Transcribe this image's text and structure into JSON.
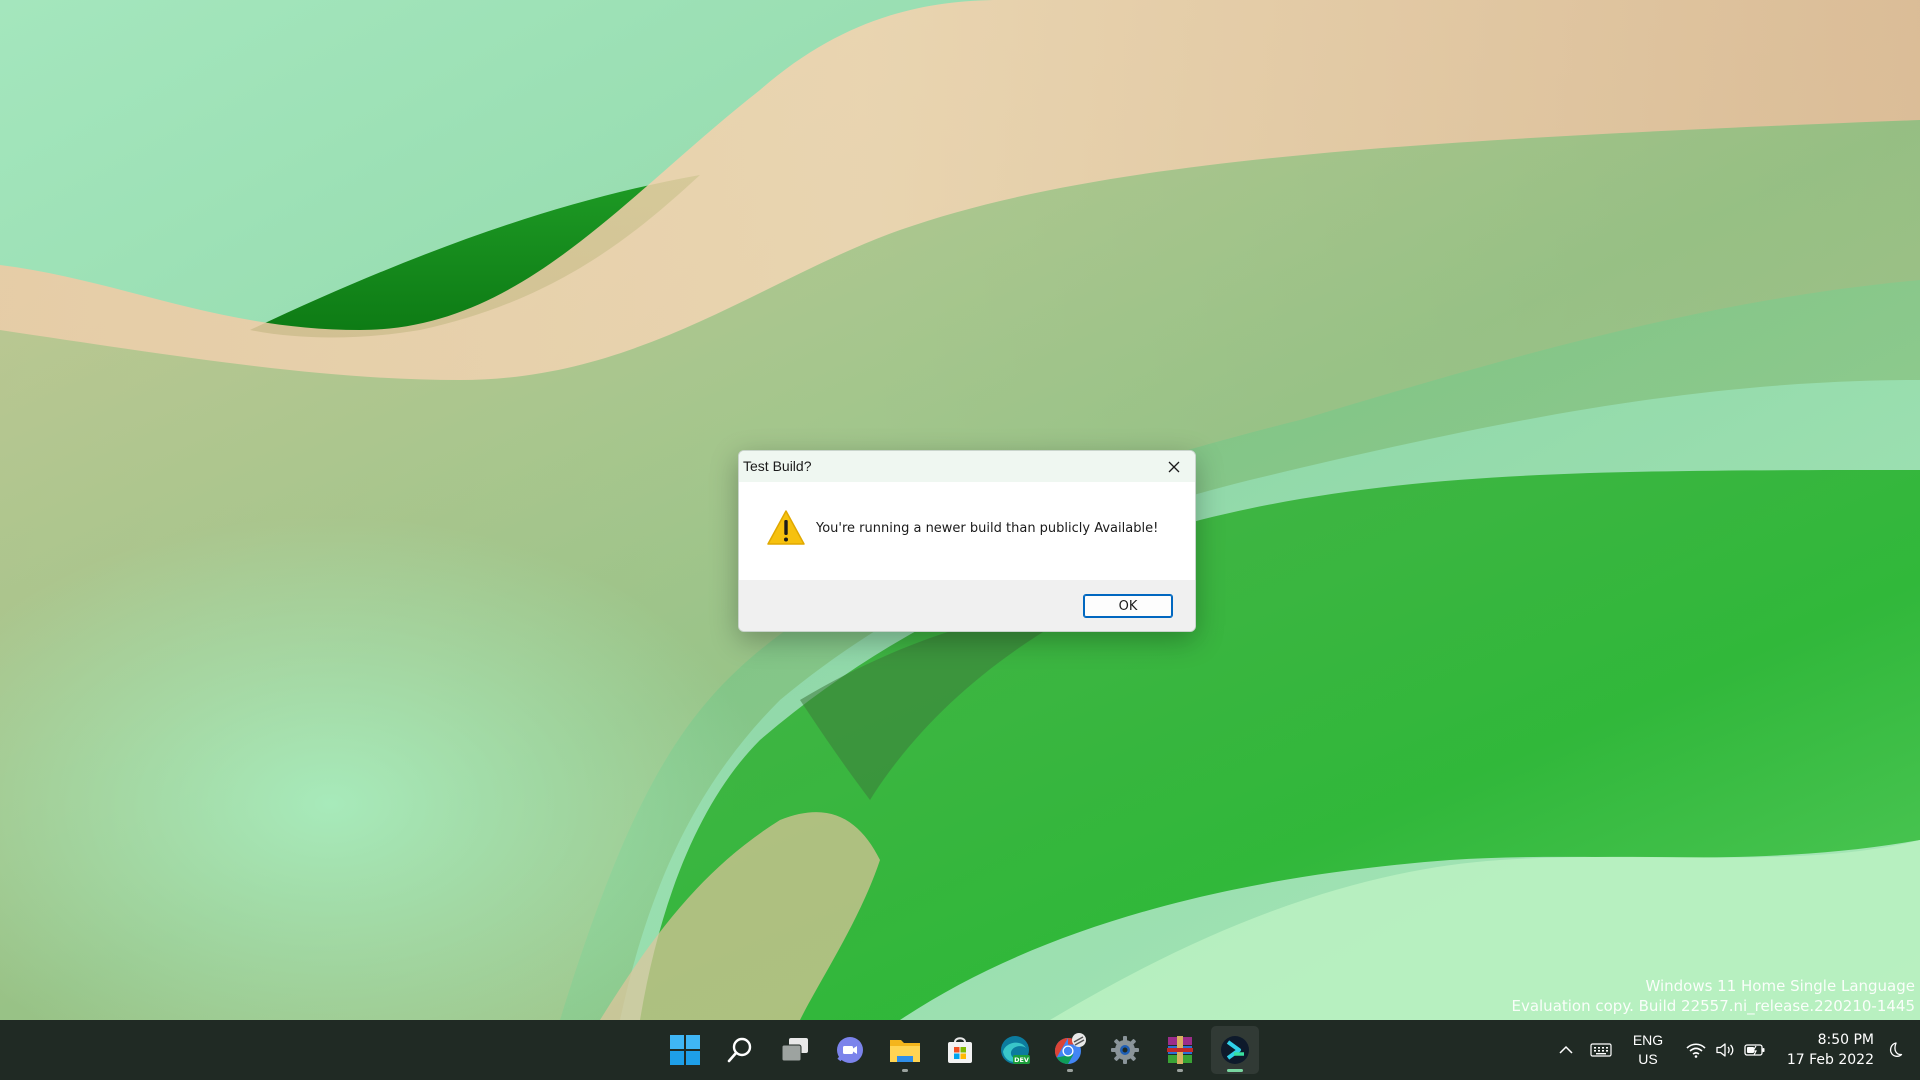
{
  "dialog": {
    "title": "Test Build?",
    "message": "You're running a newer build than publicly Available!",
    "ok_label": "OK",
    "icon": "warning-icon"
  },
  "watermark": {
    "line1": "Windows 11 Home Single Language",
    "line2": "Evaluation copy. Build 22557.ni_release.220210-1445"
  },
  "taskbar": {
    "apps": [
      {
        "name": "start-icon"
      },
      {
        "name": "search-icon"
      },
      {
        "name": "task-view-icon"
      },
      {
        "name": "teams-chat-icon"
      },
      {
        "name": "file-explorer-icon",
        "running": true
      },
      {
        "name": "microsoft-store-icon"
      },
      {
        "name": "edge-dev-icon"
      },
      {
        "name": "chrome-beta-icon",
        "running": true
      },
      {
        "name": "settings-icon"
      },
      {
        "name": "winrar-icon",
        "running": true
      },
      {
        "name": "terminal-app-icon",
        "active": true
      }
    ],
    "tray": {
      "language": "ENG",
      "region": "US",
      "time": "8:50 PM",
      "date": "17 Feb 2022"
    }
  },
  "colors": {
    "taskbar_bg": "#202a24",
    "accent": "#0067c0",
    "warning": "#f6c10e"
  }
}
